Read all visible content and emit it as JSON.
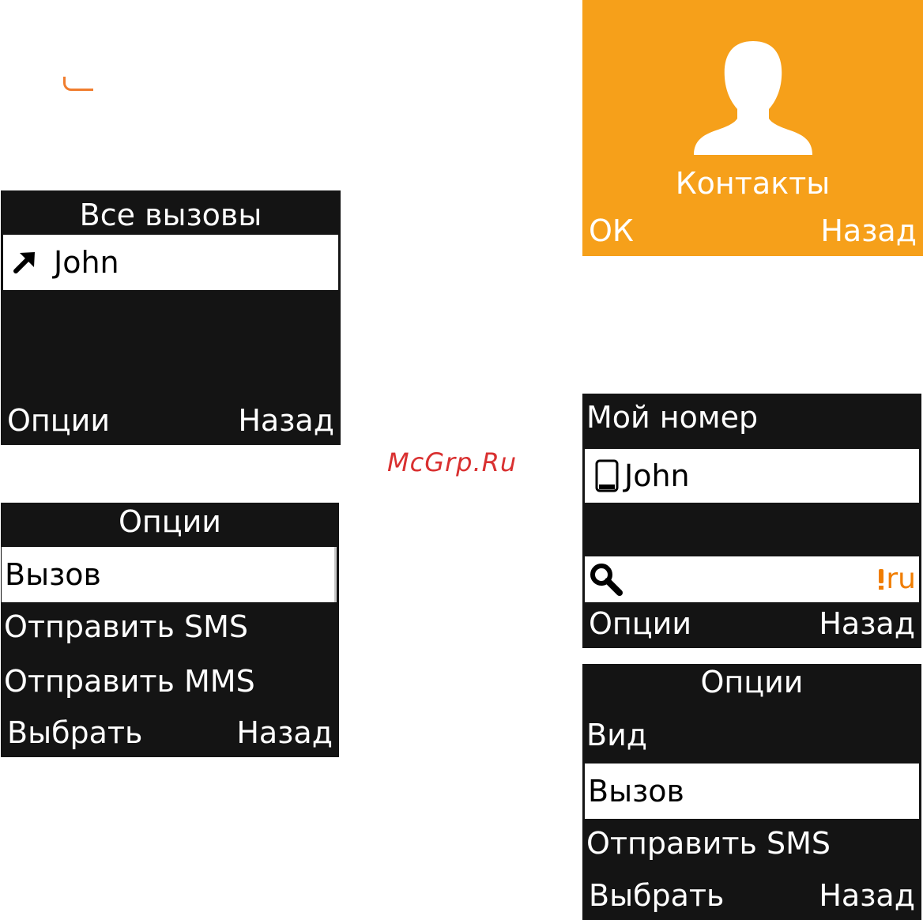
{
  "calls_screen": {
    "title": "Все вызовы",
    "entries": [
      {
        "name": "John",
        "icon": "outgoing-call-arrow-icon"
      }
    ],
    "softkey_left": "Опции",
    "softkey_right": "Назад"
  },
  "call_options_screen": {
    "title": "Опции",
    "items": [
      "Вызов",
      "Отправить SMS",
      "Отправить MMS"
    ],
    "selected_index": 0,
    "softkey_left": "Выбрать",
    "softkey_right": "Назад"
  },
  "watermark": "McGrp.Ru",
  "contacts_menu": {
    "label": "Контакты",
    "icon": "person-icon",
    "softkey_left": "ОК",
    "softkey_right": "Назад",
    "background_color": "#f6a01a"
  },
  "my_number_screen": {
    "title": "Мой номер",
    "entries": [
      {
        "name": "John",
        "icon": "mobile-phone-icon"
      }
    ],
    "search": {
      "icon": "search-icon",
      "input_mode": "ru"
    },
    "softkey_left": "Опции",
    "softkey_right": "Назад"
  },
  "contact_options_screen": {
    "title": "Опции",
    "items": [
      "Вид",
      "Вызов",
      "Отправить SMS"
    ],
    "selected_index": 1,
    "softkey_left": "Выбрать",
    "softkey_right": "Назад"
  },
  "colors": {
    "screen_bg": "#141414",
    "accent_orange": "#f6a01a",
    "input_mode_orange": "#f07d00",
    "watermark_red": "#d93030"
  }
}
